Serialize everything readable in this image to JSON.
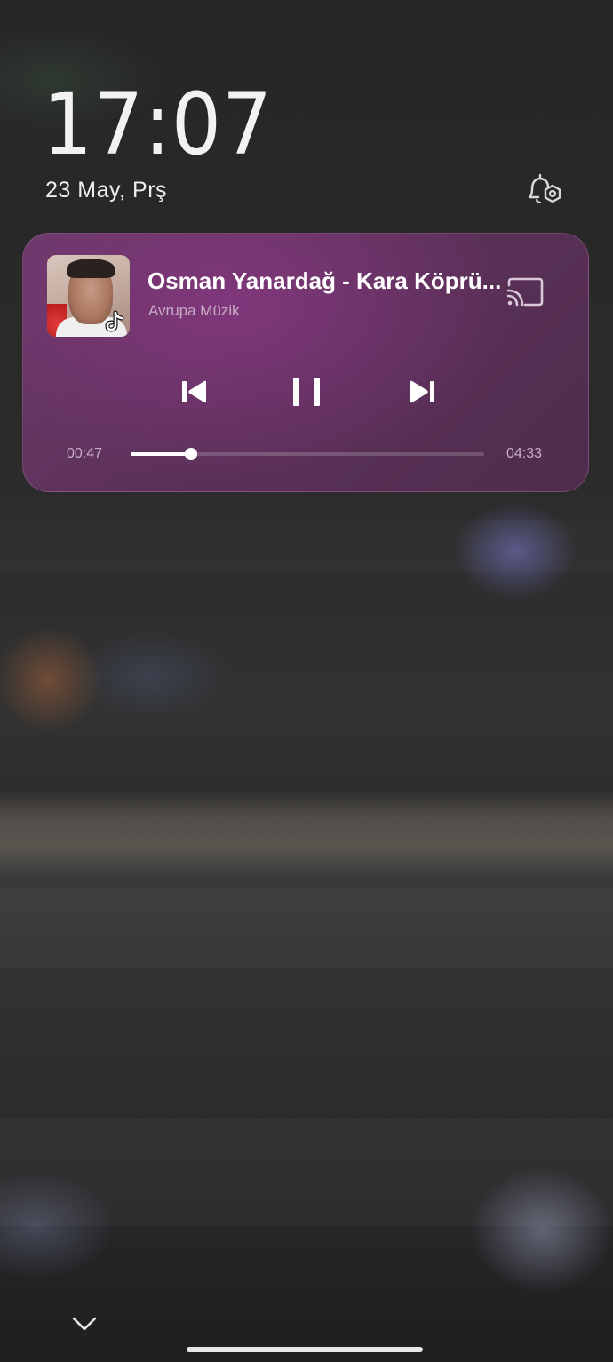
{
  "lock_screen": {
    "time": "17:07",
    "date": "23 May, Prş"
  },
  "media": {
    "title": "Osman Yanardağ - Kara Köprü...",
    "artist": "Avrupa Müzik",
    "elapsed": "00:47",
    "duration": "04:33",
    "progress_fraction": 0.172,
    "is_playing": true,
    "controls": [
      "previous-icon",
      "pause-icon",
      "next-icon"
    ],
    "card_color": "#5c3159",
    "accent": "#ffffff"
  },
  "icons": {
    "notification_settings": "bell-settings-icon",
    "cast": "cast-icon",
    "app_badge": "tiktok-icon",
    "expand": "chevron-down-icon"
  }
}
